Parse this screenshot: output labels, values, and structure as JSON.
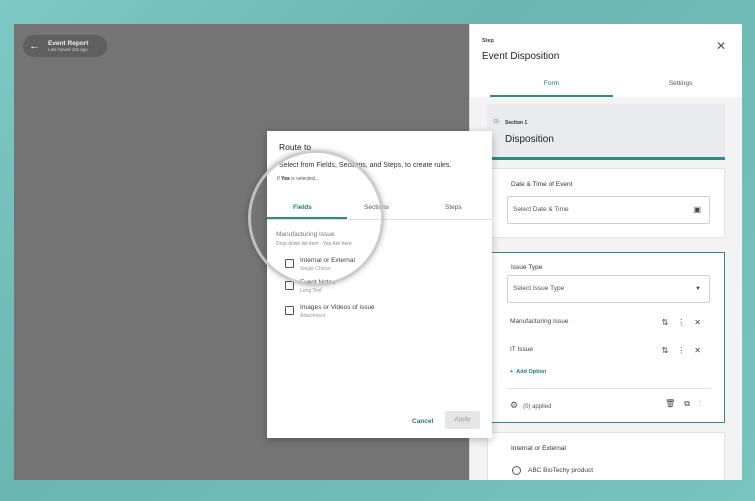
{
  "topbar": {
    "back_title": "Event Report",
    "back_subtitle": "Last Saved 10s ago"
  },
  "panel": {
    "step_label": "Step",
    "title": "Event Disposition",
    "tabs": [
      {
        "label": "Form",
        "active": true
      },
      {
        "label": "Settings",
        "active": false
      }
    ],
    "section": {
      "label": "Section 1",
      "title": "Disposition"
    },
    "date_field": {
      "label": "Date & Time of Event",
      "placeholder": "Select Date & Time"
    },
    "issue_field": {
      "label": "Issue Type",
      "placeholder": "Select Issue Type",
      "options": [
        {
          "label": "Manufacturing Issue"
        },
        {
          "label": "IT Issue"
        }
      ],
      "add_option": "Add Option",
      "applied": "(0) applied"
    },
    "internal_field": {
      "label": "Internal or External",
      "option": "ABC BioTechy product"
    }
  },
  "modal": {
    "title": "Route to",
    "subtitle": "Select from Fields, Sections, and Steps, to create rules.",
    "condition_prefix": "If",
    "condition_value": "Yes",
    "condition_suffix": "is selected...",
    "tabs": [
      {
        "label": "Fields",
        "active": true
      },
      {
        "label": "Sections",
        "active": false
      },
      {
        "label": "Steps",
        "active": false
      }
    ],
    "group_title": "Manufacturing Issue",
    "group_subtitle": "Drop down list item - You Are here",
    "items": [
      {
        "label": "Internal or External",
        "type": "Single Choice"
      },
      {
        "label": "Event Notes",
        "type": "Long Text"
      },
      {
        "label": "Images or Videos of issue",
        "type": "Attachment"
      }
    ],
    "cancel": "Cancel",
    "apply": "Apply"
  },
  "colors": {
    "accent": "#2e8c80",
    "overlay": "#747474"
  }
}
